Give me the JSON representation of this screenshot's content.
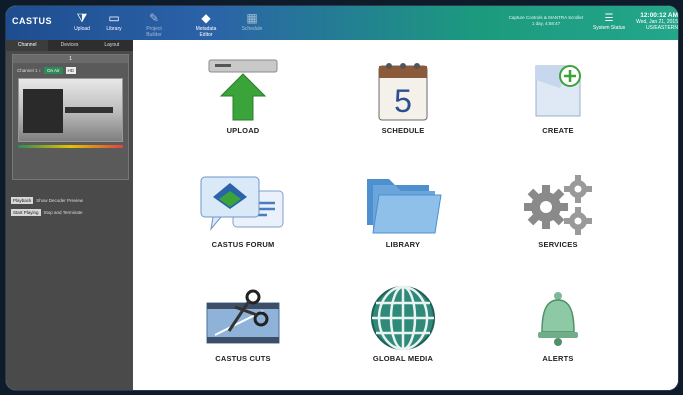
{
  "app": {
    "brand": "CASTUS"
  },
  "toolbar": {
    "items": [
      {
        "label": "Upload",
        "icon": "filter-icon"
      },
      {
        "label": "Library",
        "icon": "folder-icon"
      },
      {
        "label": "Project Builder",
        "icon": "pencil-icon"
      },
      {
        "label": "Metadata Editor",
        "icon": "tag-icon"
      },
      {
        "label": "Schedule",
        "icon": "grid-icon"
      }
    ]
  },
  "status": {
    "line1": "Capture Controls & MANTRA Scroller",
    "line2": "1 day, 4:58:47",
    "system_status": "System Status"
  },
  "clock": {
    "time": "12:00:12 AM",
    "date": "Wed, Jan 21, 2015",
    "zone": "US/EASTERN"
  },
  "sidebar": {
    "tabs": [
      "Channel",
      "Devices",
      "Layout"
    ],
    "channel_label": "1",
    "display_label": "Channel 1 ↕",
    "toggle_label": "On Air",
    "hd_label": "HD",
    "rows": [
      {
        "button": "Playback",
        "text": "Show Decoder Preview"
      },
      {
        "button": "Start Playing",
        "text": "Stop and Terminate"
      }
    ]
  },
  "tiles": [
    {
      "label": "UPLOAD",
      "icon": "upload-icon"
    },
    {
      "label": "SCHEDULE",
      "icon": "calendar-icon",
      "day": "5"
    },
    {
      "label": "CREATE",
      "icon": "create-document-icon"
    },
    {
      "label": "CASTUS FORUM",
      "icon": "forum-icon"
    },
    {
      "label": "LIBRARY",
      "icon": "library-folder-icon"
    },
    {
      "label": "SERVICES",
      "icon": "gears-icon"
    },
    {
      "label": "CASTUS CUTS",
      "icon": "scissors-film-icon"
    },
    {
      "label": "GLOBAL MEDIA",
      "icon": "globe-icon"
    },
    {
      "label": "ALERTS",
      "icon": "bell-icon"
    }
  ],
  "colors": {
    "accent_blue": "#2b62a8",
    "accent_green": "#23a68a",
    "upload_green": "#3aa33a"
  }
}
